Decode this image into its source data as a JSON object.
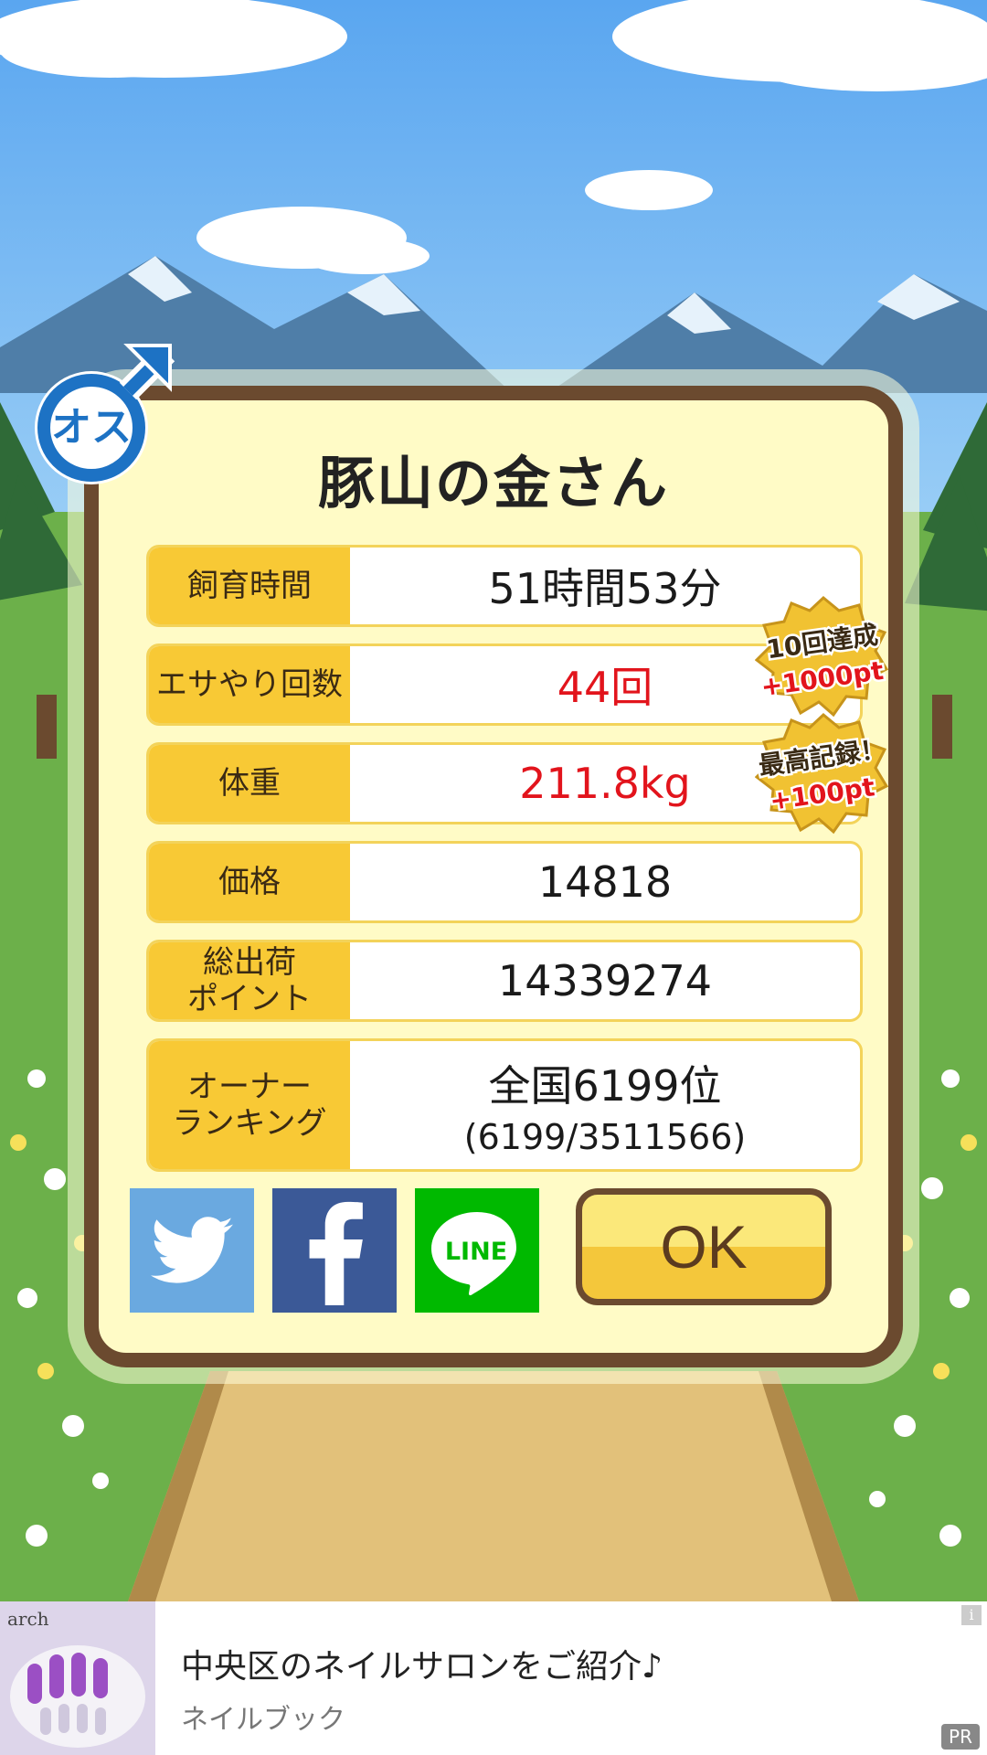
{
  "pig_name": "豚山の金さん",
  "gender_label": "オス",
  "stats": [
    {
      "label": "飼育時間",
      "value": "51時間53分"
    },
    {
      "label": "エサやり回数",
      "value": "44回"
    },
    {
      "label": "体重",
      "value": "211.8kg"
    },
    {
      "label": "価格",
      "value": "14818"
    },
    {
      "label": "総出荷\nポイント",
      "value": "14339274"
    },
    {
      "label": "オーナー\nランキング",
      "value": "全国6199位",
      "sub": "(6199/3511566)"
    }
  ],
  "badges": [
    {
      "line1": "10回達成",
      "line2": "+1000pt"
    },
    {
      "line1": "最高記録！",
      "line2": "+100pt"
    }
  ],
  "social": {
    "twitter": "twitter-share",
    "facebook": "facebook-share",
    "line": "LINE"
  },
  "ok_label": "OK",
  "ad": {
    "title": "中央区のネイルサロンをご紹介♪",
    "subtitle": "ネイルブック",
    "pr": "PR",
    "info": "i",
    "thumb_brand": "arch"
  },
  "colors": {
    "accent_red": "#e2141c",
    "label_yellow": "#f8c935",
    "frame_brown": "#6b4a2f"
  }
}
